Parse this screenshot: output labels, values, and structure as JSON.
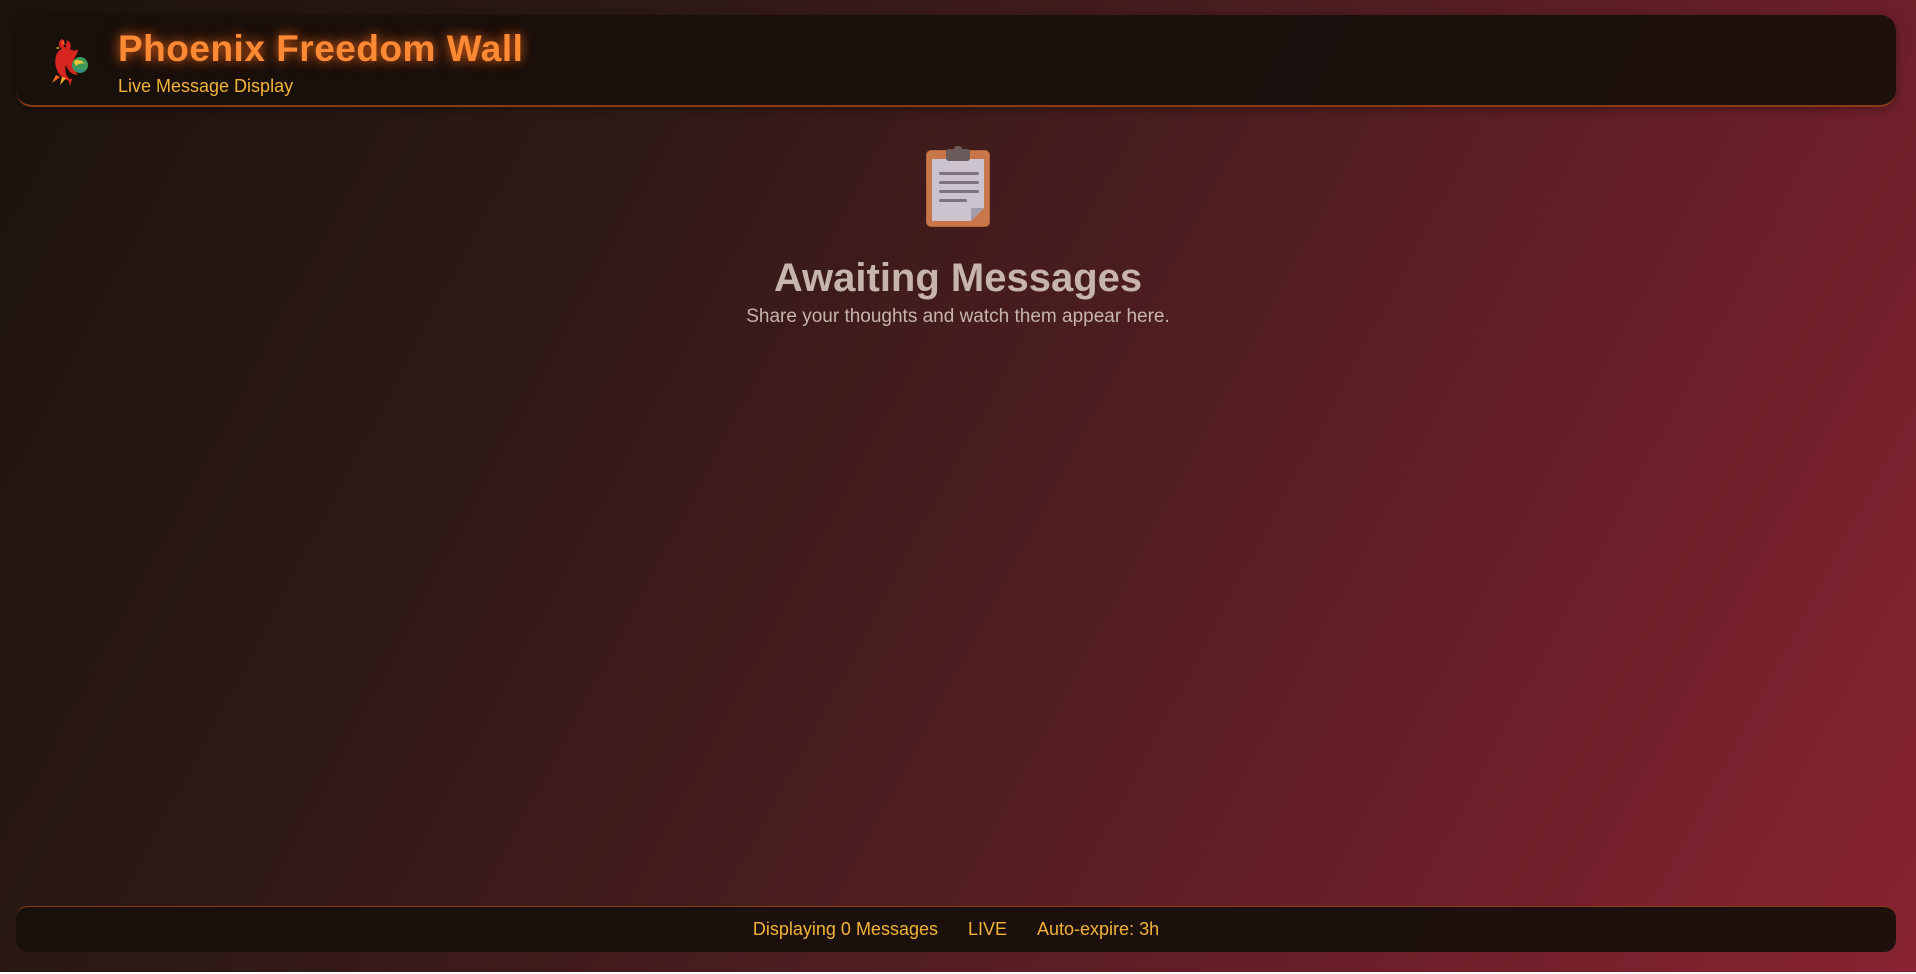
{
  "header": {
    "logo_icon": "phoenix-bird-icon",
    "title": "Phoenix Freedom Wall",
    "subtitle": "Live Message Display"
  },
  "empty_state": {
    "icon": "clipboard-icon",
    "title": "Awaiting Messages",
    "text": "Share your thoughts and watch them appear here."
  },
  "footer": {
    "count_label": "Displaying 0 Messages",
    "live_label": "LIVE",
    "expire_label": "Auto-expire: 3h"
  },
  "colors": {
    "accent_orange": "#ff8a33",
    "accent_gold": "#f2b338",
    "muted_text": "#c7b5ad",
    "gradient_dark": "#1c120e",
    "gradient_red": "#882333"
  }
}
